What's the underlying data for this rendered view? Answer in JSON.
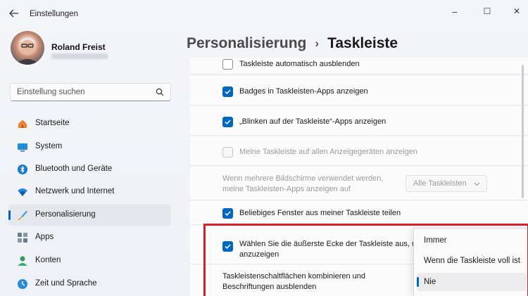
{
  "window": {
    "title": "Einstellungen",
    "back_icon": "arrow-left-icon",
    "minimize_glyph": "–",
    "maximize_glyph": "☐",
    "close_glyph": "✕"
  },
  "profile": {
    "name": "Roland Freist"
  },
  "search": {
    "placeholder": "Einstellung suchen"
  },
  "sidebar": {
    "items": [
      {
        "label": "Startseite",
        "icon": "home-icon"
      },
      {
        "label": "System",
        "icon": "monitor-icon"
      },
      {
        "label": "Bluetooth und Geräte",
        "icon": "bluetooth-icon"
      },
      {
        "label": "Netzwerk und Internet",
        "icon": "wifi-icon"
      },
      {
        "label": "Personalisierung",
        "icon": "brush-icon",
        "selected": true
      },
      {
        "label": "Apps",
        "icon": "apps-icon"
      },
      {
        "label": "Konten",
        "icon": "account-icon"
      },
      {
        "label": "Zeit und Sprache",
        "icon": "clock-globe-icon"
      }
    ]
  },
  "breadcrumb": {
    "parent": "Personalisierung",
    "separator": "›",
    "current": "Taskleiste"
  },
  "settings": {
    "autohide": {
      "label": "Taskleiste automatisch ausblenden",
      "checked": false
    },
    "badges": {
      "label": "Badges in Taskleisten-Apps anzeigen",
      "checked": true
    },
    "flashing": {
      "label": "„Blinken auf der Taskleiste“-Apps anzeigen",
      "checked": true
    },
    "all_displays": {
      "label": "Meine Taskleiste auf allen Anzeigegeräten anzeigen",
      "checked": false,
      "disabled": true
    },
    "multi_display": {
      "line1": "Wenn mehrere Bildschirme verwendet werden,",
      "line2": "meine Taskleisten-Apps anzeigen auf",
      "value": "Alle Taskleisten"
    },
    "share_window": {
      "label": "Beliebiges Fenster aus meiner Taskleiste teilen",
      "checked": true
    },
    "far_corner": {
      "line1": "Wählen Sie die äußerste Ecke der Taskleiste aus, u",
      "line2": "anzuzeigen",
      "checked": true
    },
    "combine": {
      "line1": "Taskleistenschaltflächen kombinieren und",
      "line2": "Beschriftungen ausblenden"
    }
  },
  "dropdown": {
    "options": [
      {
        "label": "Immer",
        "selected": false
      },
      {
        "label": "Wenn die Taskleiste voll ist",
        "selected": false
      },
      {
        "label": "Nie",
        "selected": true
      }
    ]
  },
  "colors": {
    "accent": "#0067c0",
    "highlight_box": "#d3232a"
  }
}
